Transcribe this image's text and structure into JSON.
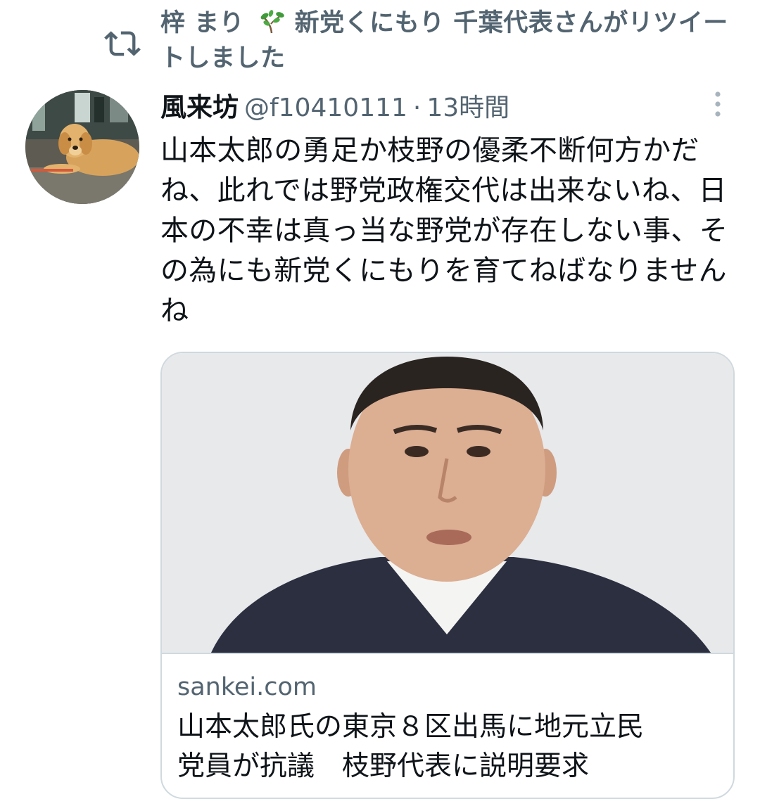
{
  "retweet": {
    "icon": "retweet-icon",
    "name": "梓 まり",
    "emoji": "sprout-icon",
    "text": "新党くにもり 千葉代表さんがリツイートしました"
  },
  "tweet": {
    "avatar": "golden-retriever-avatar",
    "display_name": "風来坊",
    "handle": "@f10410111",
    "separator": "·",
    "time": "13時間",
    "body": "山本太郎の勇足か枝野の優柔不断何方かだね、此れでは野党政権交代は出来ないね、日本の不幸は真っ当な野党が存在しない事、その為にも新党くにもりを育てねばなりませんね"
  },
  "card": {
    "image": "news-photo-man-in-suit",
    "domain": "sankei.com",
    "headline_line1": "山本太郎氏の東京８区出馬に地元立民",
    "headline_line2": "党員が抗議　枝野代表に説明要求"
  },
  "colors": {
    "text_primary": "#0f1419",
    "text_secondary": "#536471",
    "border": "#cfd9de"
  }
}
